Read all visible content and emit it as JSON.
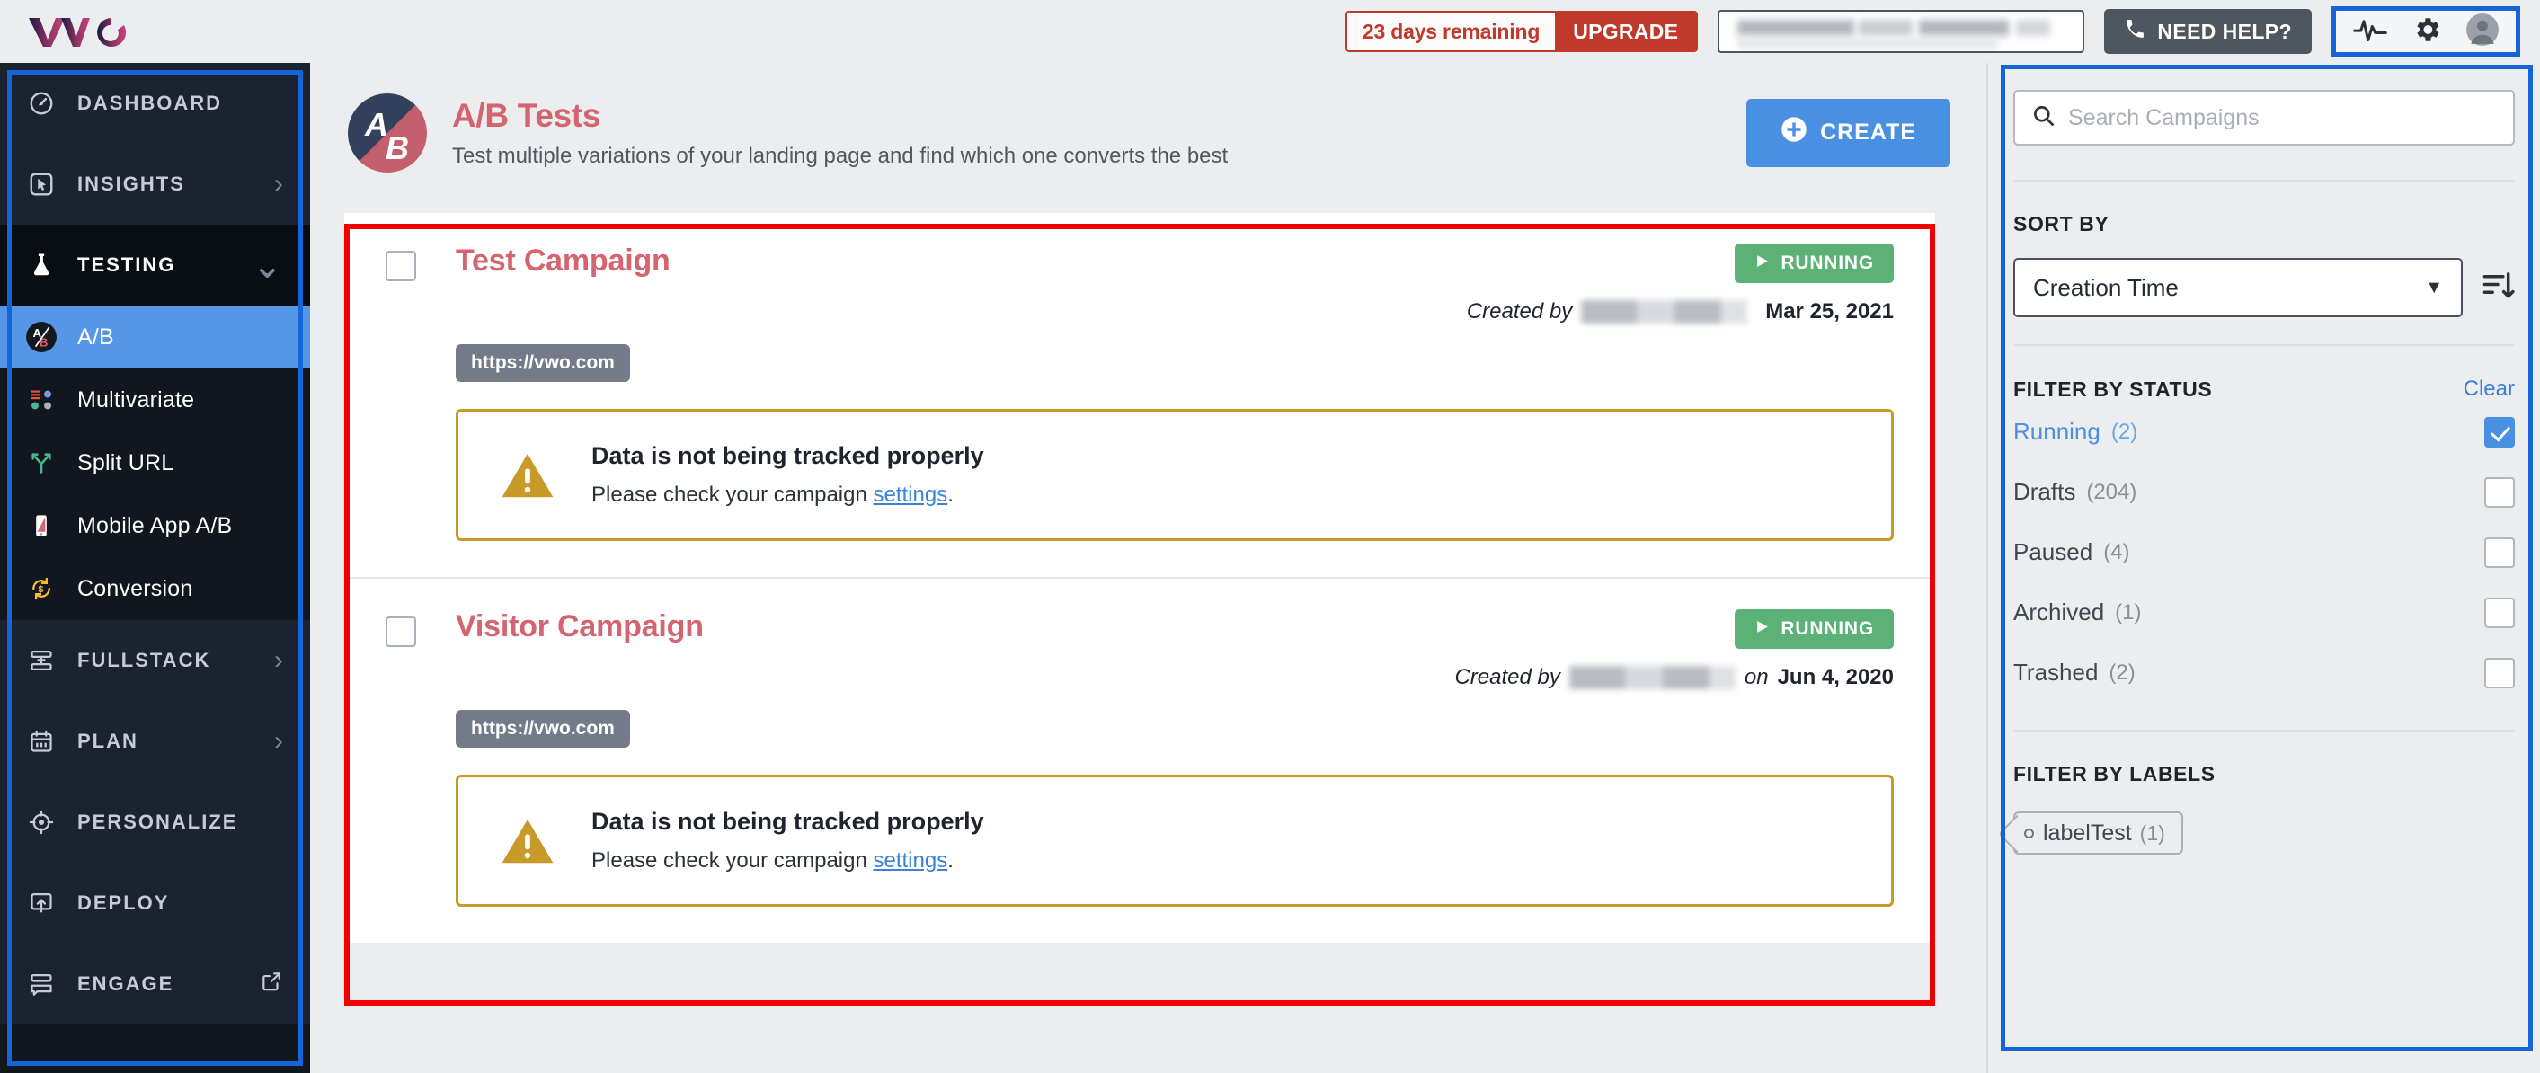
{
  "topbar": {
    "logo_alt": "VWO",
    "trial_days": "23 days remaining",
    "upgrade_label": "UPGRADE",
    "need_help_label": "NEED HELP?",
    "icons": [
      "activity-pulse-icon",
      "gear-icon",
      "user-avatar-icon"
    ]
  },
  "sidebar": {
    "items": [
      {
        "label": "DASHBOARD",
        "icon": "speedometer-icon",
        "chevron": "",
        "type": "group"
      },
      {
        "label": "INSIGHTS",
        "icon": "cursor-box-icon",
        "chevron": "›",
        "type": "group"
      },
      {
        "label": "TESTING",
        "icon": "flask-icon",
        "chevron": "∨",
        "type": "group-open"
      },
      {
        "label": "A/B",
        "icon": "ab-circle-icon",
        "chevron": "",
        "type": "sub-active"
      },
      {
        "label": "Multivariate",
        "icon": "multivariate-dots-icon",
        "chevron": "",
        "type": "sub"
      },
      {
        "label": "Split URL",
        "icon": "split-fork-icon",
        "chevron": "",
        "type": "sub"
      },
      {
        "label": "Mobile App A/B",
        "icon": "mobile-phone-icon",
        "chevron": "",
        "type": "sub"
      },
      {
        "label": "Conversion",
        "icon": "conversion-dollar-icon",
        "chevron": "",
        "type": "sub"
      },
      {
        "label": "FULLSTACK",
        "icon": "stack-server-icon",
        "chevron": "›",
        "type": "group"
      },
      {
        "label": "PLAN",
        "icon": "calendar-icon",
        "chevron": "›",
        "type": "group"
      },
      {
        "label": "PERSONALIZE",
        "icon": "target-icon",
        "chevron": "",
        "type": "group"
      },
      {
        "label": "DEPLOY",
        "icon": "deploy-upload-icon",
        "chevron": "",
        "type": "group"
      },
      {
        "label": "ENGAGE",
        "icon": "engage-stack-icon",
        "chevron": "external-link-icon",
        "type": "group"
      }
    ]
  },
  "page": {
    "badge_a": "A",
    "badge_b": "B",
    "title": "A/B Tests",
    "subtitle": "Test multiple variations of your landing page and find which one converts the best",
    "create_label": "CREATE"
  },
  "campaigns": [
    {
      "name": "Test Campaign",
      "url": "https://vwo.com",
      "status": "RUNNING",
      "created_prefix": "Created by",
      "created_middle": "",
      "created_date": "Mar 25, 2021",
      "alert_title": "Data is not being tracked properly",
      "alert_text_before": "Please check your campaign ",
      "alert_link": "settings",
      "alert_text_after": "."
    },
    {
      "name": "Visitor Campaign",
      "url": "https://vwo.com",
      "status": "RUNNING",
      "created_prefix": "Created by",
      "created_middle": "on",
      "created_date": "Jun 4, 2020",
      "alert_title": "Data is not being tracked properly",
      "alert_text_before": "Please check your campaign ",
      "alert_link": "settings",
      "alert_text_after": "."
    }
  ],
  "rightpanel": {
    "search_placeholder": "Search Campaigns",
    "sort_heading": "SORT BY",
    "sort_value": "Creation Time",
    "status_heading": "FILTER BY STATUS",
    "clear_label": "Clear",
    "statuses": [
      {
        "name": "Running",
        "count": "(2)",
        "checked": true
      },
      {
        "name": "Drafts",
        "count": "(204)",
        "checked": false
      },
      {
        "name": "Paused",
        "count": "(4)",
        "checked": false
      },
      {
        "name": "Archived",
        "count": "(1)",
        "checked": false
      },
      {
        "name": "Trashed",
        "count": "(2)",
        "checked": false
      }
    ],
    "labels_heading": "FILTER BY LABELS",
    "labels": [
      {
        "name": "labelTest",
        "count": "(1)"
      }
    ]
  },
  "colors": {
    "accent_blue": "#4a90e2",
    "brand_red": "#d4646f",
    "running_green": "#5cb176",
    "warn_gold": "#c79a2a",
    "upgrade_red": "#c0392b",
    "annotation_red": "#f20000",
    "annotation_blue": "#1565d8"
  }
}
